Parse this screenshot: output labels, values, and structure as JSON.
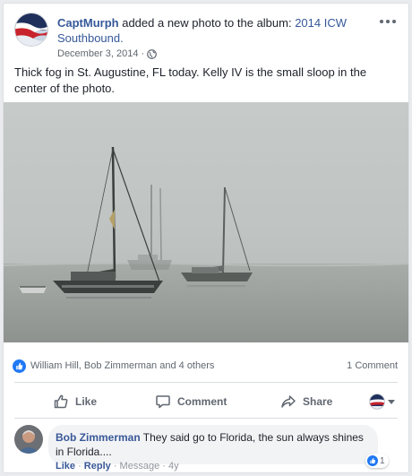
{
  "post": {
    "author": "CaptMurph",
    "action_text": " added a new photo to the album: ",
    "album": "2014 ICW Southbound.",
    "date": "December 3, 2014 · ",
    "caption": "Thick fog in St. Augustine, FL today. Kelly IV is the small sloop in the center of the photo.",
    "privacy_icon": "globe-icon",
    "menu_icon": "more-options-icon"
  },
  "reactions": {
    "names": "William Hill, Bob Zimmerman and 4 others",
    "comment_count": "1 Comment"
  },
  "actions": {
    "like_label": "Like",
    "comment_label": "Comment",
    "share_label": "Share"
  },
  "comment": {
    "author": "Bob Zimmerman",
    "text": " They said go to Florida, the sun always shines in Florida....",
    "reaction_count": "1",
    "like_link": "Like",
    "reply_link": "Reply",
    "sep1": " · ",
    "message_link": "Message",
    "sep2": " · ",
    "age": "4y"
  },
  "colors": {
    "link_blue": "#365899",
    "like_blue": "#2078f4",
    "muted_gray": "#606770",
    "bubble_bg": "#f2f3f5"
  }
}
